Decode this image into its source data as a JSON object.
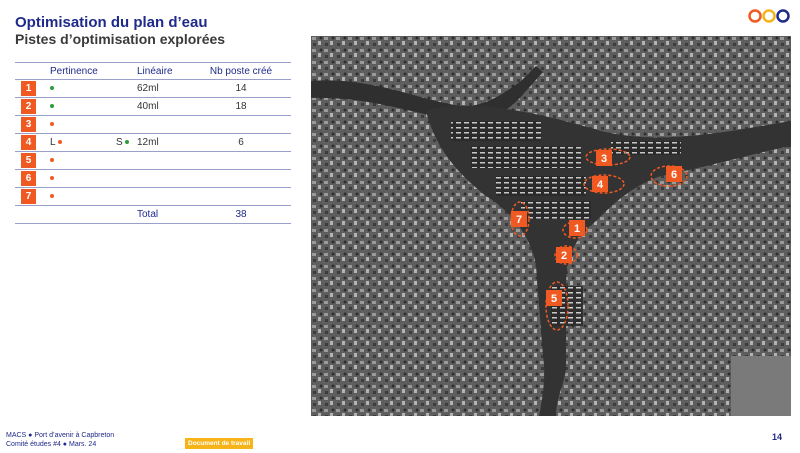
{
  "header": {
    "title": "Optimisation du plan d’eau",
    "subtitle": "Pistes d’optimisation explorées"
  },
  "logo": {
    "colors": [
      "#f05a22",
      "#f6b419",
      "#1f2a8a"
    ]
  },
  "table": {
    "columns": [
      "Pertinence",
      "Linéaire",
      "Nb poste créé"
    ],
    "rows": [
      {
        "num": "1",
        "pertinence": [
          {
            "label": "",
            "color": "green"
          }
        ],
        "lineaire": "62ml",
        "nb": "14"
      },
      {
        "num": "2",
        "pertinence": [
          {
            "label": "",
            "color": "green"
          }
        ],
        "lineaire": "40ml",
        "nb": "18"
      },
      {
        "num": "3",
        "pertinence": [
          {
            "label": "",
            "color": "orange"
          }
        ],
        "lineaire": "",
        "nb": ""
      },
      {
        "num": "4",
        "pertinence": [
          {
            "label": "L",
            "color": "orange"
          },
          {
            "label": "S",
            "color": "green"
          }
        ],
        "lineaire": "12ml",
        "nb": "6"
      },
      {
        "num": "5",
        "pertinence": [
          {
            "label": "",
            "color": "orange"
          }
        ],
        "lineaire": "",
        "nb": ""
      },
      {
        "num": "6",
        "pertinence": [
          {
            "label": "",
            "color": "orange"
          }
        ],
        "lineaire": "",
        "nb": ""
      },
      {
        "num": "7",
        "pertinence": [
          {
            "label": "",
            "color": "orange"
          }
        ],
        "lineaire": "",
        "nb": ""
      }
    ],
    "total_label": "Total",
    "total_value": "38"
  },
  "map": {
    "markers": [
      {
        "label": "1"
      },
      {
        "label": "2"
      },
      {
        "label": "3"
      },
      {
        "label": "4"
      },
      {
        "label": "5"
      },
      {
        "label": "6"
      },
      {
        "label": "7"
      }
    ],
    "marker_color": "#f05a22"
  },
  "footer": {
    "line1": "MACS ● Port d’avenir à Capbreton",
    "line2": "Comité études #4 ● Mars. 24",
    "badge": "Document de travail",
    "page": "14"
  },
  "colors": {
    "accent": "#f05a22",
    "brand": "#1f2a8a",
    "badge": "#f6b419",
    "green": "#2e9c3c"
  }
}
